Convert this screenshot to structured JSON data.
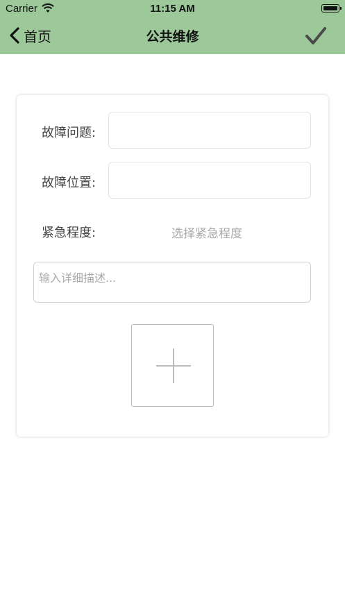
{
  "status_bar": {
    "carrier": "Carrier",
    "time": "11:15 AM"
  },
  "nav": {
    "back_label": "首页",
    "title": "公共维修"
  },
  "form": {
    "fault_issue_label": "故障问题:",
    "fault_location_label": "故障位置:",
    "urgency_label": "紧急程度:",
    "urgency_placeholder": "选择紧急程度",
    "description_placeholder": "输入详细描述..."
  },
  "colors": {
    "nav_background": "#9dc99a",
    "checkmark": "#4a4a4a"
  },
  "icons": {
    "back": "chevron-left-icon",
    "confirm": "checkmark-icon",
    "add_photo": "plus-icon"
  }
}
